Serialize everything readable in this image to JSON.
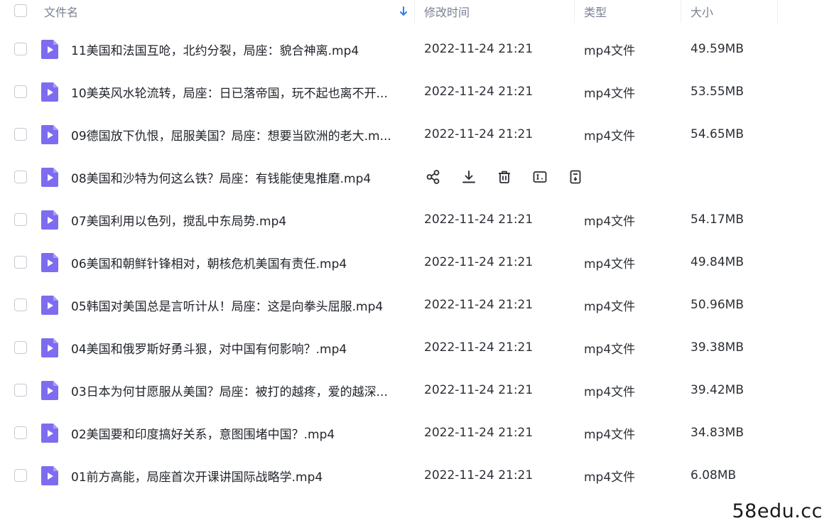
{
  "header": {
    "name_label": "文件名",
    "modified_label": "修改时间",
    "type_label": "类型",
    "size_label": "大小",
    "sort_icon": "arrow-down-icon"
  },
  "colors": {
    "file_icon": "#7d6cf0",
    "header_text": "#7a8090",
    "sort_arrow": "#2f7cf6"
  },
  "files": [
    {
      "name": "11美国和法国互呛，北约分裂，局座：貌合神离.mp4",
      "modified": "2022-11-24 21:21",
      "type": "mp4文件",
      "size": "49.59MB"
    },
    {
      "name": "10美英风水轮流转，局座：日已落帝国，玩不起也离不开...",
      "modified": "2022-11-24 21:21",
      "type": "mp4文件",
      "size": "53.55MB"
    },
    {
      "name": "09德国放下仇恨，屈服美国？局座：想要当欧洲的老大.m...",
      "modified": "2022-11-24 21:21",
      "type": "mp4文件",
      "size": "54.65MB"
    },
    {
      "name": "08美国和沙特为何这么铁？局座：有钱能使鬼推磨.mp4",
      "modified": "",
      "type": "",
      "size": "",
      "hovered": true
    },
    {
      "name": "07美国利用以色列，搅乱中东局势.mp4",
      "modified": "2022-11-24 21:21",
      "type": "mp4文件",
      "size": "54.17MB"
    },
    {
      "name": "06美国和朝鲜针锋相对，朝核危机美国有责任.mp4",
      "modified": "2022-11-24 21:21",
      "type": "mp4文件",
      "size": "49.84MB"
    },
    {
      "name": "05韩国对美国总是言听计从！局座：这是向拳头屈服.mp4",
      "modified": "2022-11-24 21:21",
      "type": "mp4文件",
      "size": "50.96MB"
    },
    {
      "name": "04美国和俄罗斯好勇斗狠，对中国有何影响？.mp4",
      "modified": "2022-11-24 21:21",
      "type": "mp4文件",
      "size": "39.38MB"
    },
    {
      "name": "03日本为何甘愿服从美国？局座：被打的越疼，爱的越深...",
      "modified": "2022-11-24 21:21",
      "type": "mp4文件",
      "size": "39.42MB"
    },
    {
      "name": "02美国要和印度搞好关系，意图围堵中国？.mp4",
      "modified": "2022-11-24 21:21",
      "type": "mp4文件",
      "size": "34.83MB"
    },
    {
      "name": "01前方高能，局座首次开课讲国际战略学.mp4",
      "modified": "2022-11-24 21:21",
      "type": "mp4文件",
      "size": "6.08MB"
    }
  ],
  "hover_actions": [
    {
      "icon": "share-icon"
    },
    {
      "icon": "download-icon"
    },
    {
      "icon": "delete-icon"
    },
    {
      "icon": "rename-icon"
    },
    {
      "icon": "more-icon"
    }
  ],
  "watermark": "58edu.cc"
}
